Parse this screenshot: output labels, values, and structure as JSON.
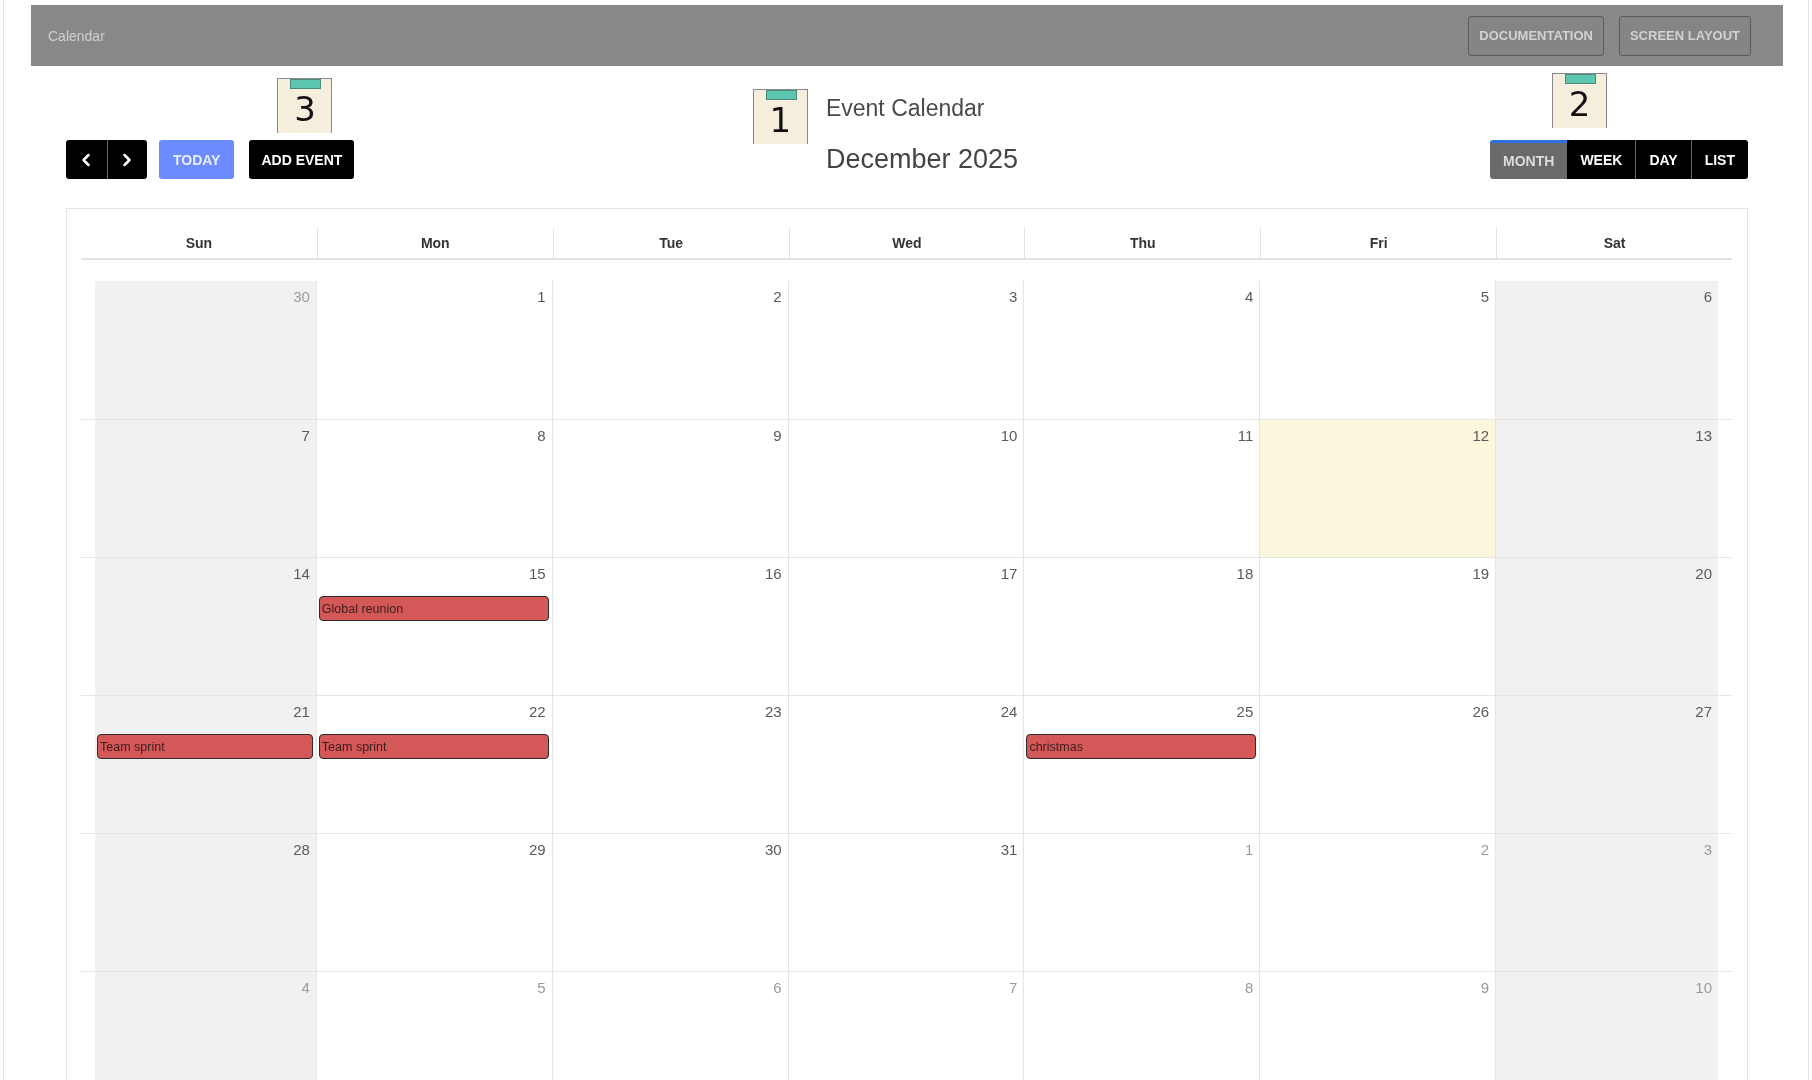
{
  "top_bar": {
    "title": "Calendar",
    "buttons": [
      "DOCUMENTATION",
      "SCREEN LAYOUT"
    ]
  },
  "toolbar": {
    "nav_buttons": [
      {
        "kind": "prev"
      },
      {
        "kind": "next"
      }
    ],
    "today_button": "TODAY",
    "add_event_button": {
      "label": "ADD EVENT",
      "marker": "3"
    }
  },
  "heading": {
    "marker": "1",
    "title": "Event Calendar",
    "period": "December 2025"
  },
  "views": {
    "marker": "2",
    "items": [
      {
        "label": "MONTH",
        "selected": true
      },
      {
        "label": "WEEK",
        "selected": false
      },
      {
        "label": "DAY",
        "selected": false
      },
      {
        "label": "LIST",
        "selected": false
      }
    ]
  },
  "calendar": {
    "weekdays": [
      {
        "label": "Sun",
        "weekend": true
      },
      {
        "label": "Mon",
        "weekend": false
      },
      {
        "label": "Tue",
        "weekend": false
      },
      {
        "label": "Wed",
        "weekend": false
      },
      {
        "label": "Thu",
        "weekend": false
      },
      {
        "label": "Fri",
        "weekend": false
      },
      {
        "label": "Sat",
        "weekend": true
      }
    ],
    "weeks": [
      [
        {
          "day": "30",
          "other_month": true,
          "today": false
        },
        {
          "day": "1",
          "other_month": false,
          "today": false
        },
        {
          "day": "2",
          "other_month": false,
          "today": false
        },
        {
          "day": "3",
          "other_month": false,
          "today": false
        },
        {
          "day": "4",
          "other_month": false,
          "today": false
        },
        {
          "day": "5",
          "other_month": false,
          "today": false
        },
        {
          "day": "6",
          "other_month": false,
          "today": false
        }
      ],
      [
        {
          "day": "7",
          "other_month": false,
          "today": false
        },
        {
          "day": "8",
          "other_month": false,
          "today": false
        },
        {
          "day": "9",
          "other_month": false,
          "today": false
        },
        {
          "day": "10",
          "other_month": false,
          "today": false
        },
        {
          "day": "11",
          "other_month": false,
          "today": false
        },
        {
          "day": "12",
          "other_month": false,
          "today": true
        },
        {
          "day": "13",
          "other_month": false,
          "today": false
        }
      ],
      [
        {
          "day": "14",
          "other_month": false,
          "today": false
        },
        {
          "day": "15",
          "other_month": false,
          "today": false,
          "events": [
            {
              "title": "Global reunion"
            }
          ]
        },
        {
          "day": "16",
          "other_month": false,
          "today": false
        },
        {
          "day": "17",
          "other_month": false,
          "today": false
        },
        {
          "day": "18",
          "other_month": false,
          "today": false
        },
        {
          "day": "19",
          "other_month": false,
          "today": false
        },
        {
          "day": "20",
          "other_month": false,
          "today": false
        }
      ],
      [
        {
          "day": "21",
          "other_month": false,
          "today": false,
          "events": [
            {
              "title": "Team sprint"
            }
          ]
        },
        {
          "day": "22",
          "other_month": false,
          "today": false,
          "events": [
            {
              "title": "Team sprint"
            }
          ]
        },
        {
          "day": "23",
          "other_month": false,
          "today": false
        },
        {
          "day": "24",
          "other_month": false,
          "today": false
        },
        {
          "day": "25",
          "other_month": false,
          "today": false,
          "events": [
            {
              "title": "christmas"
            }
          ]
        },
        {
          "day": "26",
          "other_month": false,
          "today": false
        },
        {
          "day": "27",
          "other_month": false,
          "today": false
        }
      ],
      [
        {
          "day": "28",
          "other_month": false,
          "today": false
        },
        {
          "day": "29",
          "other_month": false,
          "today": false
        },
        {
          "day": "30",
          "other_month": false,
          "today": false
        },
        {
          "day": "31",
          "other_month": false,
          "today": false
        },
        {
          "day": "1",
          "other_month": true,
          "today": false
        },
        {
          "day": "2",
          "other_month": true,
          "today": false
        },
        {
          "day": "3",
          "other_month": true,
          "today": false
        }
      ],
      [
        {
          "day": "4",
          "other_month": true,
          "today": false
        },
        {
          "day": "5",
          "other_month": true,
          "today": false
        },
        {
          "day": "6",
          "other_month": true,
          "today": false
        },
        {
          "day": "7",
          "other_month": true,
          "today": false
        },
        {
          "day": "8",
          "other_month": true,
          "today": false
        },
        {
          "day": "9",
          "other_month": true,
          "today": false
        },
        {
          "day": "10",
          "other_month": true,
          "today": false
        }
      ]
    ]
  }
}
